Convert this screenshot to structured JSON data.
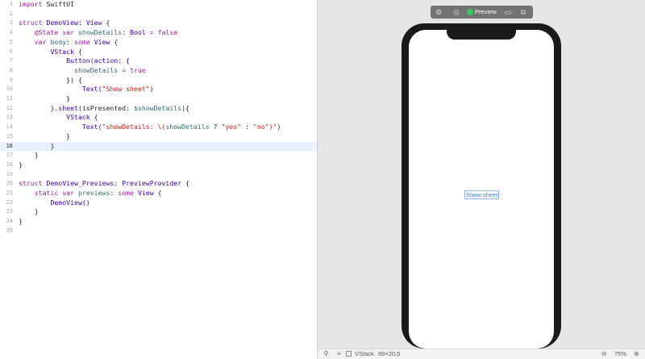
{
  "editor": {
    "current_line": 16,
    "lines": [
      {
        "n": "1"
      },
      {
        "n": "2"
      },
      {
        "n": "3"
      },
      {
        "n": "4"
      },
      {
        "n": "5"
      },
      {
        "n": "6"
      },
      {
        "n": "7"
      },
      {
        "n": "8"
      },
      {
        "n": "9"
      },
      {
        "n": "10"
      },
      {
        "n": "11"
      },
      {
        "n": "12"
      },
      {
        "n": "13"
      },
      {
        "n": "14"
      },
      {
        "n": "15"
      },
      {
        "n": "16"
      },
      {
        "n": "17"
      },
      {
        "n": "18"
      },
      {
        "n": "19"
      },
      {
        "n": "20"
      },
      {
        "n": "21"
      },
      {
        "n": "22"
      },
      {
        "n": "23"
      },
      {
        "n": "24"
      },
      {
        "n": "25"
      }
    ],
    "tokens": {
      "import": "import",
      "swiftui": "SwiftUI",
      "struct": "struct",
      "demoview": "DemoView",
      "colon": ":",
      "view": "View",
      "open_brace": "{",
      "state": "@State",
      "var": "var",
      "showdetails": "showDetails",
      "bool": "Bool",
      "eq_false": "= false",
      "body": "body",
      "some": "some",
      "vstack": "VStack",
      "button_action": "Button(action: {",
      "eq_true": "= true",
      "close_trailing": "}) {",
      "text_open": "Text(",
      "show_sheet_str": "\"Show sheet\"",
      "close_paren": ")",
      "close_brace": "}",
      "close_brace_dot": "}.",
      "sheet": "sheet",
      "is_presented": "(isPresented: ",
      "binding": "$showDetails",
      "paren_brace": "){",
      "details_str_start": "\"showDetails: \\(",
      "ternary_q": " ? ",
      "yes_str": "\"yes\"",
      "ternary_c": " : ",
      "no_str": "\"no\"",
      "details_str_end": ")\"",
      "previews_struct": "DemoView_Previews",
      "preview_provider": "PreviewProvider",
      "static": "static",
      "previews": "previews",
      "demoview_call": "DemoView()"
    }
  },
  "preview": {
    "toolbar": {
      "settings_icon": "gear-icon",
      "inspect_icon": "inspect-icon",
      "status_color": "#34c759",
      "label": "Preview",
      "device_icon": "device-icon",
      "duplicate_icon": "duplicate-icon"
    },
    "button_label": "Show sheet"
  },
  "bottom_bar": {
    "selection": "VStack",
    "size": "89×20,5",
    "zoom": "75%"
  }
}
